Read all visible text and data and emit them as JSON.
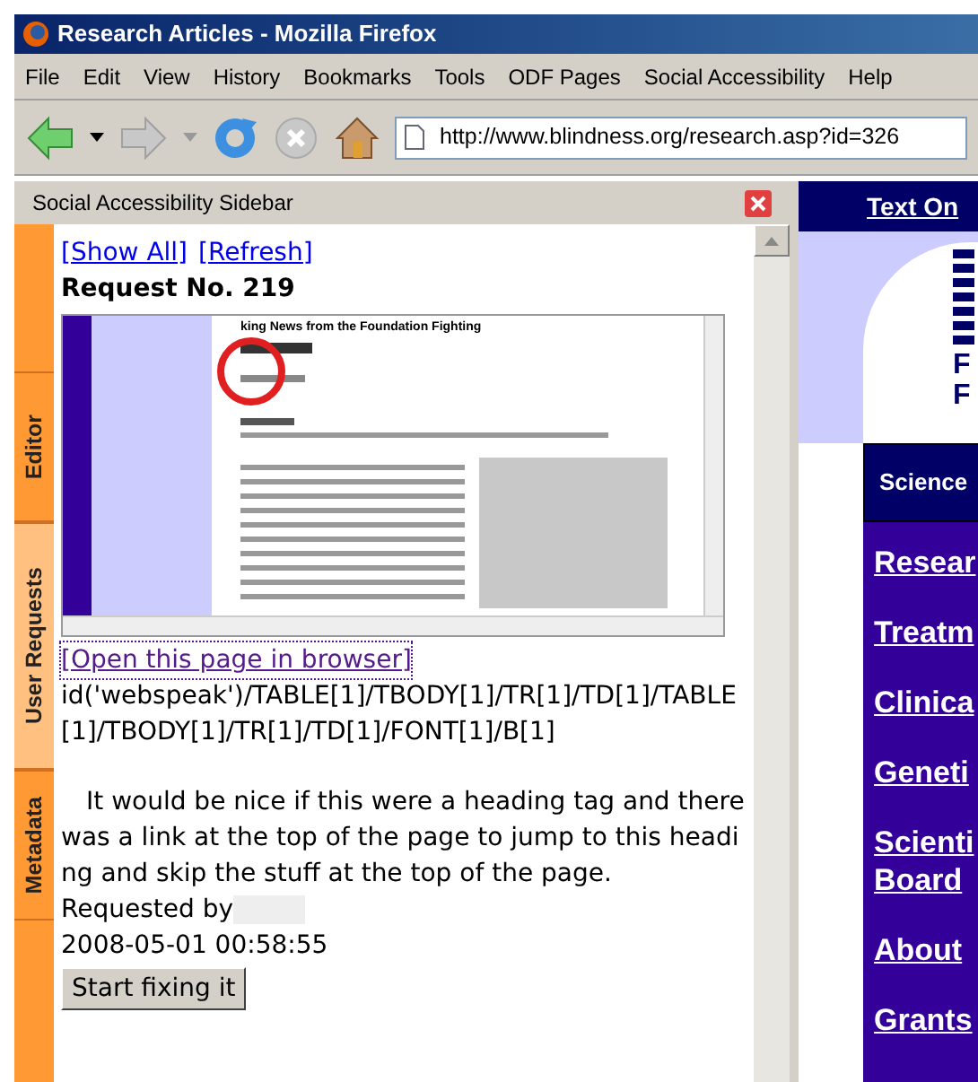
{
  "window": {
    "title": "Research Articles - Mozilla Firefox"
  },
  "menu": [
    "File",
    "Edit",
    "View",
    "History",
    "Bookmarks",
    "Tools",
    "ODF Pages",
    "Social Accessibility",
    "Help"
  ],
  "toolbar": {
    "address": "http://www.blindness.org/research.asp?id=326"
  },
  "sidebar": {
    "title": "Social Accessibility Sidebar",
    "tabs": [
      {
        "label": "Editor",
        "selected": false
      },
      {
        "label": "User Requests",
        "selected": true
      },
      {
        "label": "Metadata",
        "selected": false
      }
    ],
    "links": [
      "[Show All]",
      "[Refresh]"
    ],
    "request_title": "Request No. 219",
    "preview": {
      "heading": "king News from the Foundation Fighting"
    },
    "open_link": "[Open this page in browser]",
    "xpath": "id('webspeak')/TABLE[1]/TBODY[1]/TR[1]/TD[1]/TABLE[1]/TBODY[1]/TR[1]/TD[1]/FONT[1]/B[1]",
    "comment": "It would be nice if this were a heading tag and there was a link at the top of the page to jump to this heading and skip the stuff at the top of the page.",
    "requested_by": "Requested by",
    "timestamp": "2008-05-01 00:58:55",
    "button": "Start fixing it"
  },
  "page": {
    "top_link": "Text On",
    "logo_lines": [
      "F",
      "F"
    ],
    "section": "Science",
    "nav": [
      "Resear",
      "Treatm",
      "Clinica",
      "Geneti",
      "Scienti Board",
      "About",
      "Grants"
    ]
  }
}
